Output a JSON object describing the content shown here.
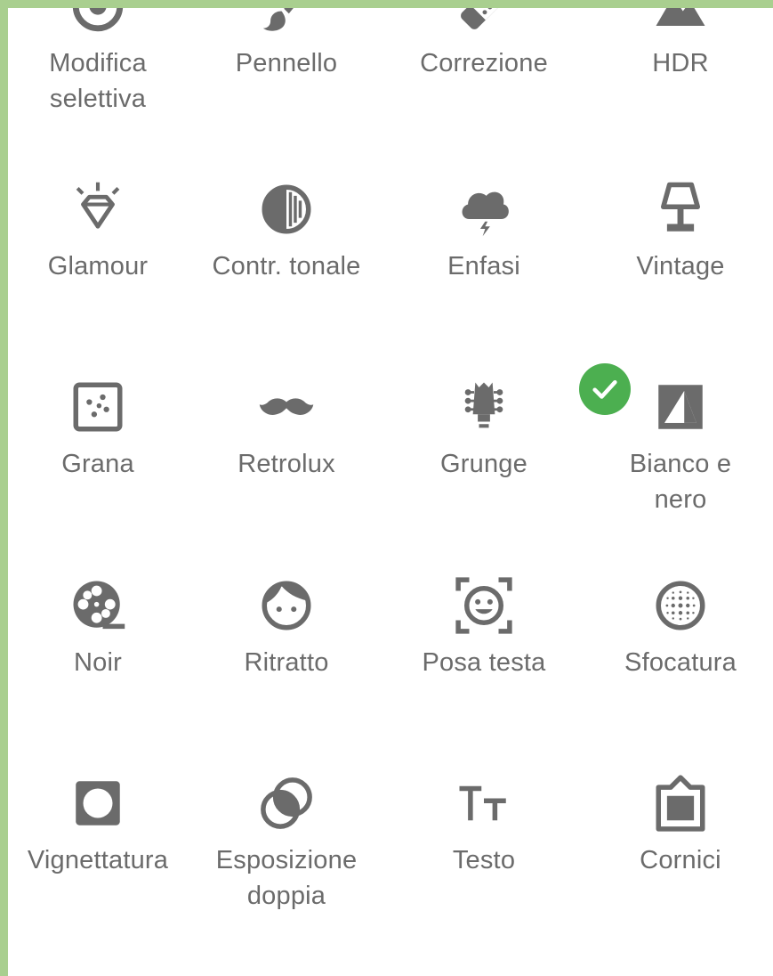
{
  "colors": {
    "frame": "#a9cf8f",
    "icon": "#6b6b6b",
    "label": "#6b6b6b",
    "check": "#4caf50"
  },
  "tools": [
    {
      "label": "Modifica\nselettiva",
      "icon": "selective-icon"
    },
    {
      "label": "Pennello",
      "icon": "brush-icon"
    },
    {
      "label": "Correzione",
      "icon": "healing-icon"
    },
    {
      "label": "HDR",
      "icon": "hdr-mountain-icon"
    },
    {
      "label": "Glamour",
      "icon": "diamond-glow-icon"
    },
    {
      "label": "Contr. tonale",
      "icon": "tonal-contrast-icon"
    },
    {
      "label": "Enfasi",
      "icon": "storm-cloud-icon"
    },
    {
      "label": "Vintage",
      "icon": "lamp-icon"
    },
    {
      "label": "Grana",
      "icon": "grain-icon"
    },
    {
      "label": "Retrolux",
      "icon": "mustache-icon"
    },
    {
      "label": "Grunge",
      "icon": "guitar-head-icon"
    },
    {
      "label": "Bianco e\nnero",
      "icon": "black-white-icon",
      "selected": true
    },
    {
      "label": "Noir",
      "icon": "film-reel-icon"
    },
    {
      "label": "Ritratto",
      "icon": "face-icon"
    },
    {
      "label": "Posa testa",
      "icon": "face-frame-icon"
    },
    {
      "label": "Sfocatura",
      "icon": "blur-icon"
    },
    {
      "label": "Vignettatura",
      "icon": "vignette-icon"
    },
    {
      "label": "Esposizione\ndoppia",
      "icon": "double-exposure-icon"
    },
    {
      "label": "Testo",
      "icon": "text-icon"
    },
    {
      "label": "Cornici",
      "icon": "frame-icon"
    }
  ]
}
